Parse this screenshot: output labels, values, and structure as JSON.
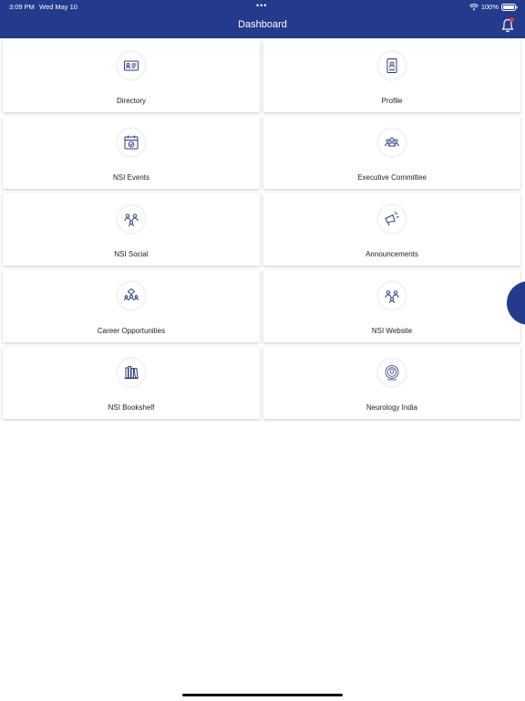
{
  "status_bar": {
    "time": "3:09 PM",
    "date": "Wed May 10",
    "dots": "•••",
    "battery_text": "100%"
  },
  "header": {
    "title": "Dashboard",
    "bell_icon": "bell-icon",
    "color": "#243a8c"
  },
  "tiles": [
    {
      "label": "Directory",
      "icon": "directory-card-icon"
    },
    {
      "label": "Profile",
      "icon": "profile-document-icon"
    },
    {
      "label": "NSI Events",
      "icon": "calendar-check-icon"
    },
    {
      "label": "Executive Committee",
      "icon": "group-icon"
    },
    {
      "label": "NSI Social",
      "icon": "social-people-icon"
    },
    {
      "label": "Announcements",
      "icon": "megaphone-icon"
    },
    {
      "label": "Career Opportunities",
      "icon": "career-network-icon"
    },
    {
      "label": "NSI Website",
      "icon": "website-people-icon"
    },
    {
      "label": "NSI Bookshelf",
      "icon": "bookshelf-icon"
    },
    {
      "label": "Neurology India",
      "icon": "neurology-india-logo-icon"
    }
  ],
  "colors": {
    "accent": "#243a8c",
    "icon_stroke": "#2b3a80",
    "notification": "#e23b3b"
  }
}
